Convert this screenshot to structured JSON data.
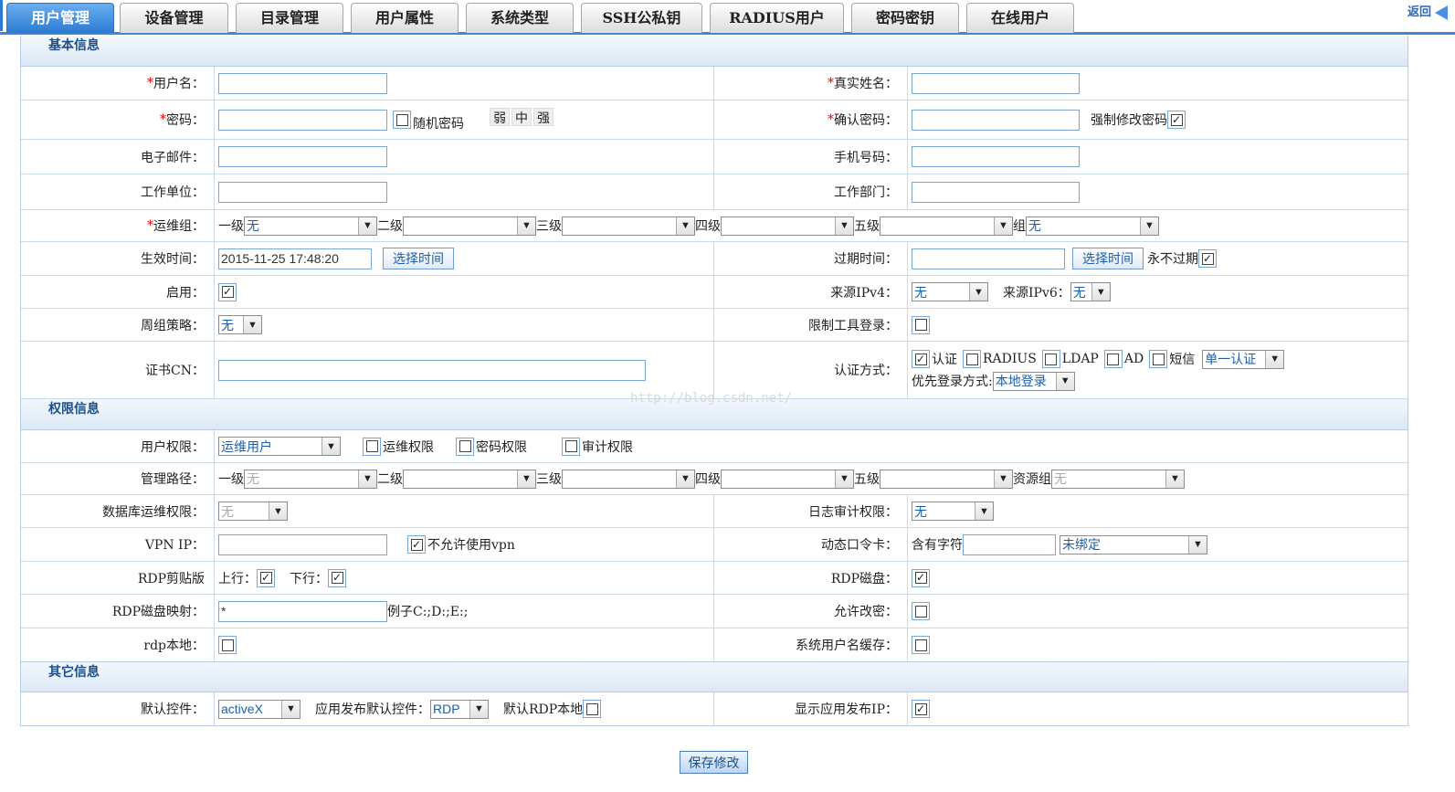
{
  "tabs": [
    {
      "label": "用户管理",
      "active": true
    },
    {
      "label": "设备管理",
      "active": false
    },
    {
      "label": "目录管理",
      "active": false
    },
    {
      "label": "用户属性",
      "active": false
    },
    {
      "label": "系统类型",
      "active": false
    },
    {
      "label": "SSH公私钥",
      "active": false
    },
    {
      "label": "RADIUS用户",
      "active": false
    },
    {
      "label": "密码密钥",
      "active": false
    },
    {
      "label": "在线用户",
      "active": false
    }
  ],
  "back_label": "返回",
  "sections": {
    "basic": "基本信息",
    "perm": "权限信息",
    "other": "其它信息"
  },
  "basic": {
    "username_label": "用户名：",
    "realname_label": "真实姓名：",
    "password_label": "密码：",
    "random_password": "随机密码",
    "strength": [
      "弱",
      "中",
      "强"
    ],
    "confirm_label": "确认密码：",
    "force_change": "强制修改密码",
    "email_label": "电子邮件：",
    "mobile_label": "手机号码：",
    "company_label": "工作单位：",
    "department_label": "工作部门：",
    "opsgroup_label": "运维组：",
    "levels": [
      "一级",
      "二级",
      "三级",
      "四级",
      "五级",
      "组"
    ],
    "level1_value": "无",
    "group_value": "无",
    "start_label": "生效时间：",
    "start_value": "2015-11-25 17:48:20",
    "choose_time": "选择时间",
    "expire_label": "过期时间：",
    "never_expire": "永不过期",
    "enable_label": "启用：",
    "src_ipv4_label": "来源IPv4：",
    "src_ipv4_value": "无",
    "src_ipv6_label": "来源IPv6：",
    "src_ipv6_value": "无",
    "weekly_label": "周组策略：",
    "weekly_value": "无",
    "limit_tool_label": "限制工具登录：",
    "cert_label": "证书CN：",
    "auth_label": "认证方式：",
    "auth_options": [
      "认证",
      "RADIUS",
      "LDAP",
      "AD",
      "短信"
    ],
    "auth_mode_value": "单一认证",
    "prefer_login_label": "优先登录方式:",
    "prefer_login_value": "本地登录"
  },
  "perm": {
    "user_perm_label": "用户权限：",
    "user_perm_value": "运维用户",
    "perm_options": [
      "运维权限",
      "密码权限",
      "审计权限"
    ],
    "mgmt_path_label": "管理路径：",
    "levels": [
      "一级",
      "二级",
      "三级",
      "四级",
      "五级",
      "资源组"
    ],
    "level1_value": "无",
    "resource_value": "无",
    "db_perm_label": "数据库运维权限：",
    "db_perm_value": "无",
    "log_audit_label": "日志审计权限：",
    "log_audit_value": "无",
    "vpn_label": "VPN IP：",
    "vpn_disallow": "不允许使用vpn",
    "token_label": "动态口令卡：",
    "token_contains": "含有字符",
    "token_value": "未绑定",
    "rdp_clip_label": "RDP剪贴版",
    "up_label": "上行：",
    "down_label": "下行：",
    "rdp_disk_label": "RDP磁盘：",
    "rdp_map_label": "RDP磁盘映射：",
    "rdp_map_value": "*",
    "rdp_map_example": "例子C:;D:;E:;",
    "allow_pwd_label": "允许改密：",
    "rdp_local_label": "rdp本地：",
    "sys_cache_label": "系统用户名缓存："
  },
  "other": {
    "default_ctrl_label": "默认控件：",
    "default_ctrl_value": "activeX",
    "app_ctrl_label": "应用发布默认控件：",
    "app_ctrl_value": "RDP",
    "default_rdp_local": "默认RDP本地",
    "show_app_ip_label": "显示应用发布IP："
  },
  "watermark": "http://blog.csdn.net/",
  "save_label": "保存修改"
}
